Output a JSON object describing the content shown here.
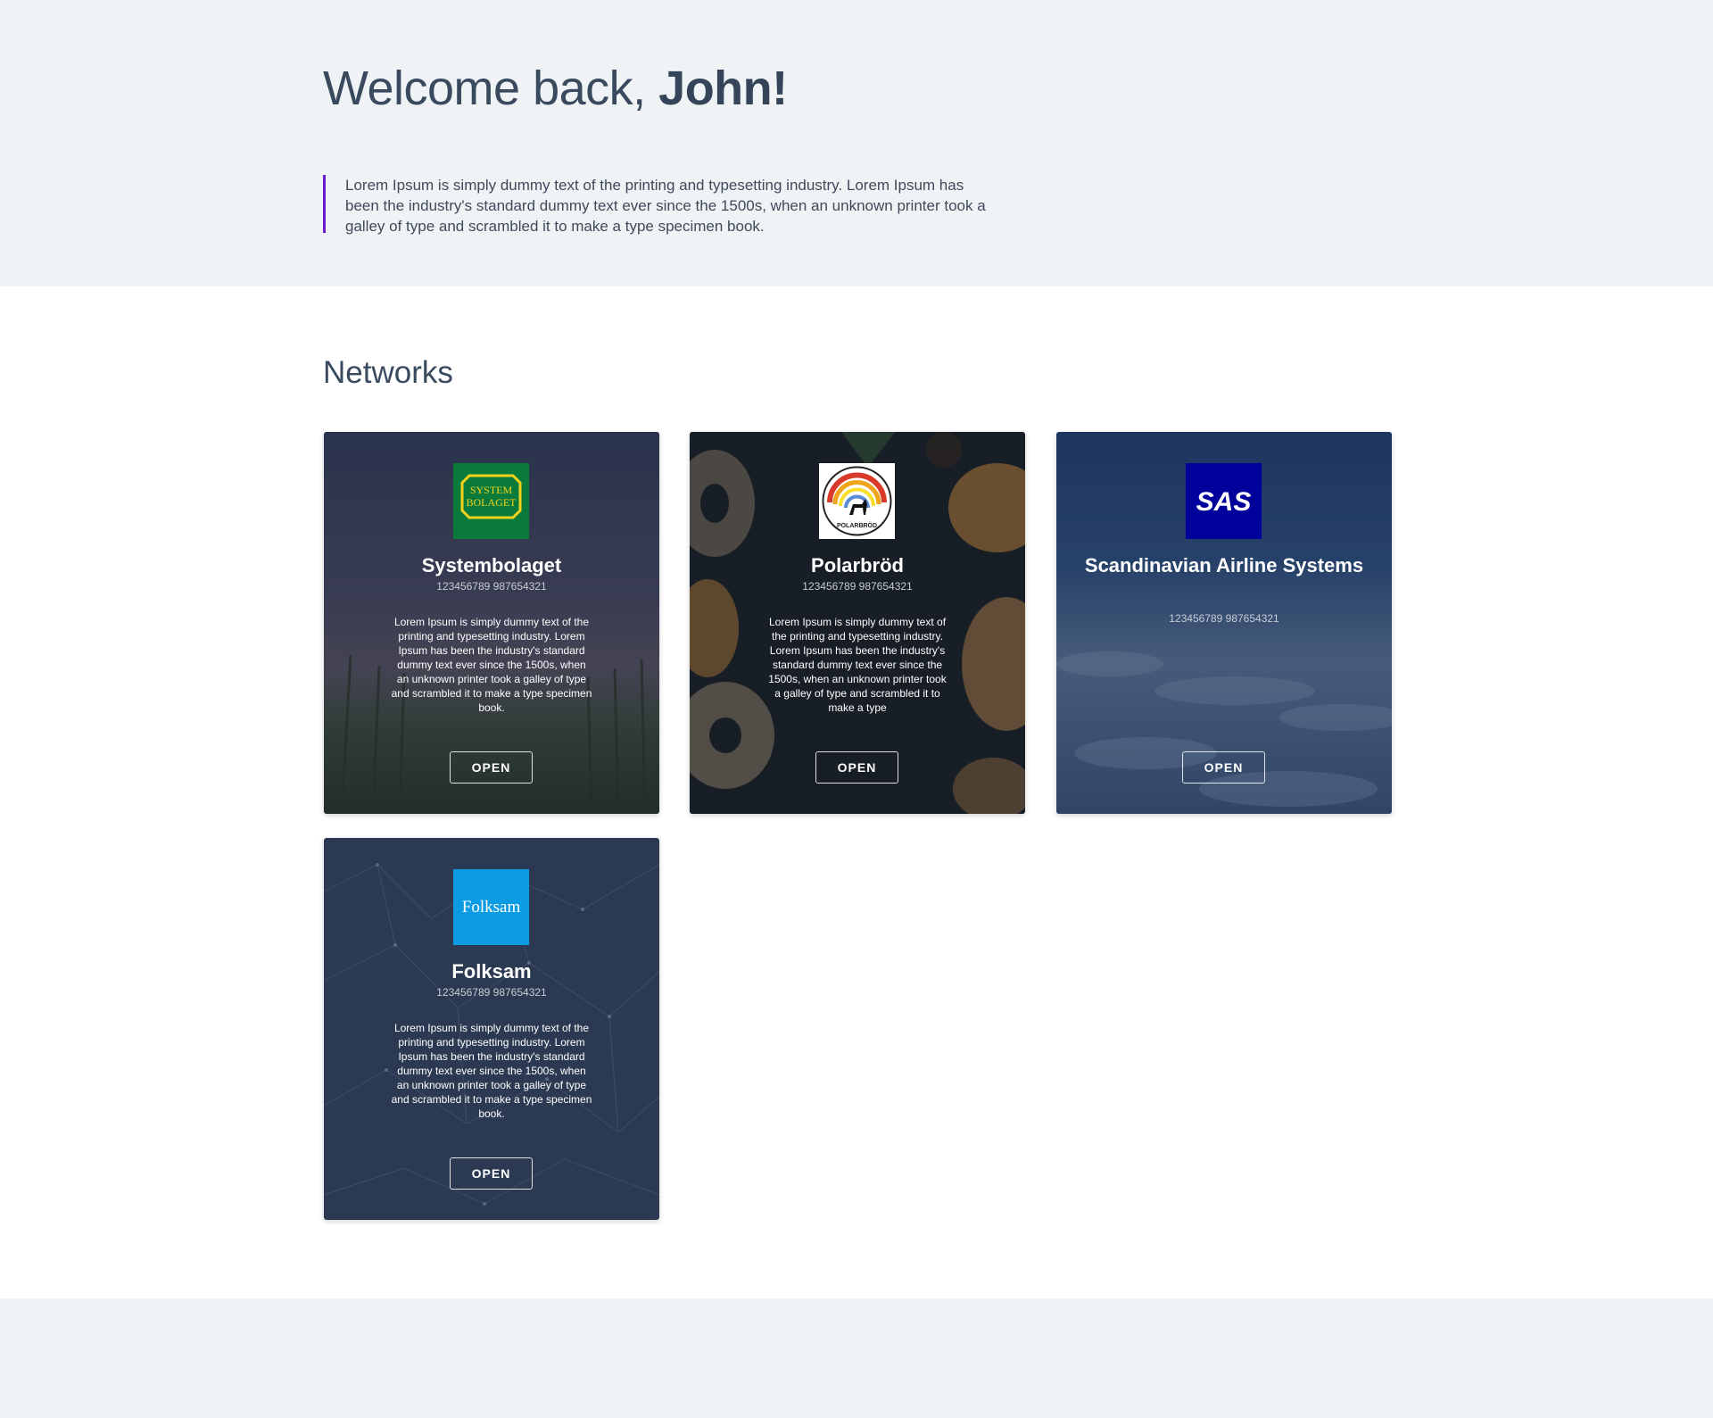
{
  "header": {
    "greeting_prefix": "Welcome back, ",
    "greeting_name": "John!",
    "intro": "Lorem Ipsum is simply dummy text of the printing and typesetting industry. Lorem Ipsum has been the industry's standard dummy text ever since the 1500s, when an unknown printer took a galley of type and scrambled it to make a type specimen book."
  },
  "networks": {
    "title": "Networks",
    "cards": [
      {
        "name": "Systembolaget",
        "id_text": "123456789 987654321",
        "description": "Lorem Ipsum is simply dummy text of the printing and typesetting industry. Lorem Ipsum has been the industry's standard dummy text ever since the 1500s, when an unknown printer took a galley of type and scrambled it to make a type specimen book.",
        "button": "OPEN",
        "logo_lines": [
          "SYSTEM",
          "BOLAGET"
        ],
        "logo_color": "#0a7a3b"
      },
      {
        "name": "Polarbröd",
        "id_text": "123456789 987654321",
        "description": "Lorem Ipsum is simply dummy text of the printing and typesetting industry. Lorem Ipsum has been the industry's standard dummy text ever since the 1500s, when an unknown printer took a galley of type and scrambled it to make a type",
        "button": "OPEN",
        "logo_text": "POLARBRÖD",
        "logo_color": "#ffffff"
      },
      {
        "name": "Scandinavian Airline Systems",
        "id_text": "123456789 987654321",
        "description": "",
        "button": "OPEN",
        "logo_text": "SAS",
        "logo_color": "#00009a"
      },
      {
        "name": "Folksam",
        "id_text": "123456789 987654321",
        "description": "Lorem Ipsum is simply dummy text of the printing and typesetting industry. Lorem Ipsum has been the industry's standard dummy text ever since the 1500s, when an unknown printer took a galley of type and scrambled it to make a type specimen book.",
        "button": "OPEN",
        "logo_text": "Folksam",
        "logo_color": "#0b9be3"
      }
    ]
  }
}
